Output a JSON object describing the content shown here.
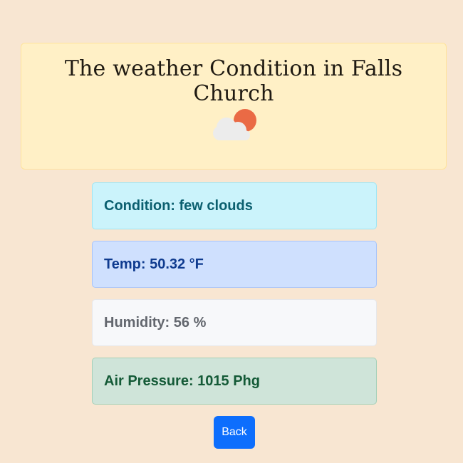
{
  "header": {
    "title": "The weather Condition in Falls Church",
    "icon": "partly-cloudy-icon"
  },
  "colors": {
    "page_background": "#f8e6d2",
    "header_background": "#fff0c6",
    "button": "#0d6efd",
    "sun": "#ea6a45",
    "cloud": "#ececec"
  },
  "info": {
    "condition": "Condition: few clouds",
    "temp": "Temp: 50.32 °F",
    "humidity": "Humidity: 56 %",
    "pressure": "Air Pressure: 1015 Phg"
  },
  "back_button": {
    "label": "Back"
  }
}
